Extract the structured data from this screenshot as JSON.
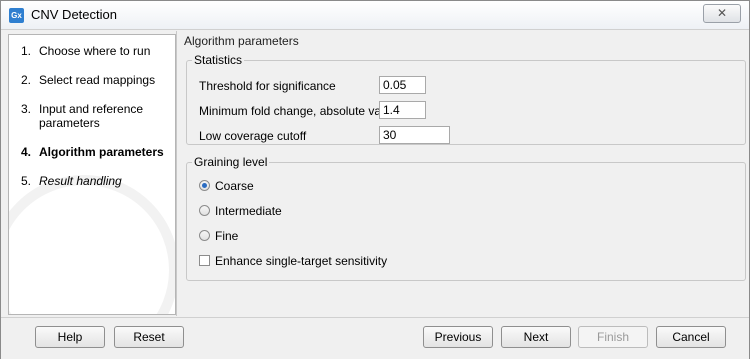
{
  "window": {
    "title": "CNV Detection",
    "app_icon_text": "Gx",
    "close_glyph": "✕"
  },
  "steps": [
    {
      "num": "1.",
      "label": "Choose where to run",
      "state": "done"
    },
    {
      "num": "2.",
      "label": "Select read mappings",
      "state": "done"
    },
    {
      "num": "3.",
      "label": "Input and reference parameters",
      "state": "done"
    },
    {
      "num": "4.",
      "label": "Algorithm parameters",
      "state": "active"
    },
    {
      "num": "5.",
      "label": "Result handling",
      "state": "pending"
    }
  ],
  "panel": {
    "title": "Algorithm parameters",
    "statistics": {
      "legend": "Statistics",
      "threshold_label": "Threshold for significance",
      "threshold_value": "0.05",
      "fold_label": "Minimum fold change, absolute value",
      "fold_value": "1.4",
      "coverage_label": "Low coverage cutoff",
      "coverage_value": "30"
    },
    "graining": {
      "legend": "Graining level",
      "options": [
        "Coarse",
        "Intermediate",
        "Fine"
      ],
      "selected": "Coarse",
      "enhance_label": "Enhance single-target sensitivity",
      "enhance_checked": false
    }
  },
  "footer": {
    "help": "Help",
    "reset": "Reset",
    "previous": "Previous",
    "next": "Next",
    "finish": "Finish",
    "cancel": "Cancel"
  },
  "colors": {
    "accent": "#2b6cc2",
    "window_bg": "#f0f0f0"
  }
}
